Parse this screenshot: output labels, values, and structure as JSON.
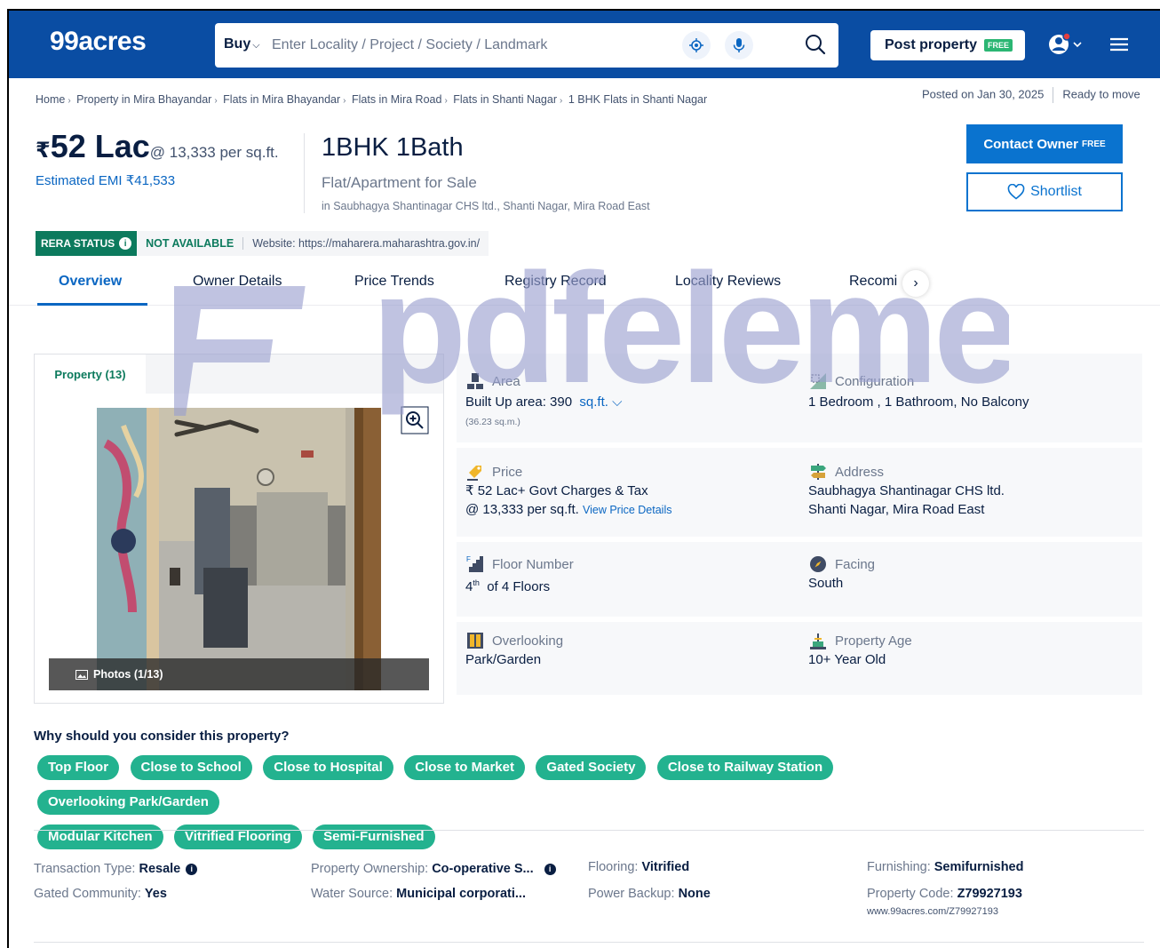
{
  "header": {
    "logo": "99acres",
    "buy_label": "Buy",
    "search_placeholder": "Enter Locality / Project / Society / Landmark",
    "post_property_label": "Post property",
    "free_tag": "FREE"
  },
  "breadcrumb": [
    "Home",
    "Property in Mira Bhayandar",
    "Flats in Mira Bhayandar",
    "Flats in Mira Road",
    "Flats in Shanti Nagar",
    "1 BHK Flats in Shanti Nagar"
  ],
  "posted": {
    "date": "Posted on Jan 30, 2025",
    "status": "Ready to move"
  },
  "listing": {
    "currency": "₹",
    "price": "52 Lac",
    "price_per_sqft": "@ 13,333 per sq.ft.",
    "emi": "Estimated EMI ₹41,533",
    "title": "1BHK 1Bath",
    "type": "Flat/Apartment for Sale",
    "address": "in Saubhagya Shantinagar CHS ltd., Shanti Nagar, Mira Road East"
  },
  "actions": {
    "contact_owner": "Contact Owner",
    "contact_free": "FREE",
    "shortlist": "Shortlist"
  },
  "rera": {
    "label": "RERA STATUS",
    "status": "NOT AVAILABLE",
    "website": "Website: https://maharera.maharashtra.gov.in/"
  },
  "tabs": [
    "Overview",
    "Owner Details",
    "Price Trends",
    "Registry Record",
    "Locality Reviews",
    "Recomi"
  ],
  "media": {
    "tab_label": "Property (13)",
    "photos_label": "Photos (1/13)"
  },
  "details": {
    "area": {
      "label": "Area",
      "value": "Built Up area: 390",
      "unit": "sq.ft.",
      "sub": "(36.23 sq.m.)"
    },
    "configuration": {
      "label": "Configuration",
      "value": "1 Bedroom , 1 Bathroom, No Balcony"
    },
    "price": {
      "label": "Price",
      "line1": "₹ 52 Lac+ Govt Charges & Tax",
      "line2": "@ 13,333 per sq.ft.",
      "link": "View Price Details"
    },
    "address": {
      "label": "Address",
      "line1": "Saubhagya Shantinagar CHS ltd.",
      "line2": "Shanti Nagar, Mira Road East"
    },
    "floor": {
      "label": "Floor Number",
      "floor": "4",
      "suffix": "th",
      "value": "of 4 Floors"
    },
    "facing": {
      "label": "Facing",
      "value": "South"
    },
    "overlooking": {
      "label": "Overlooking",
      "value": "Park/Garden"
    },
    "age": {
      "label": "Property Age",
      "value": "10+ Year Old"
    }
  },
  "why": {
    "title": "Why should you consider this property?",
    "chips": [
      "Top Floor",
      "Close to School",
      "Close to Hospital",
      "Close to Market",
      "Gated Society",
      "Close to Railway Station",
      "Overlooking Park/Garden",
      "Modular Kitchen",
      "Vitrified Flooring",
      "Semi-Furnished"
    ]
  },
  "attributes": {
    "transaction_label": "Transaction Type",
    "transaction_value": "Resale",
    "gated_label": "Gated Community",
    "gated_value": "Yes",
    "ownership_label": "Property Ownership",
    "ownership_value": "Co-operative S...",
    "water_label": "Water Source",
    "water_value": "Municipal corporati...",
    "flooring_label": "Flooring",
    "flooring_value": "Vitrified",
    "power_label": "Power Backup",
    "power_value": "None",
    "furnishing_label": "Furnishing",
    "furnishing_value": "Semifurnished",
    "code_label": "Property Code",
    "code_value": "Z79927193",
    "code_url": "www.99acres.com/Z79927193"
  },
  "watermark": {
    "text": "pdfelement"
  },
  "colors": {
    "header_blue": "#0a4da3",
    "accent_blue": "#0a73cf",
    "chip_green": "#23b28f",
    "rera_green": "#0c7a5d"
  }
}
